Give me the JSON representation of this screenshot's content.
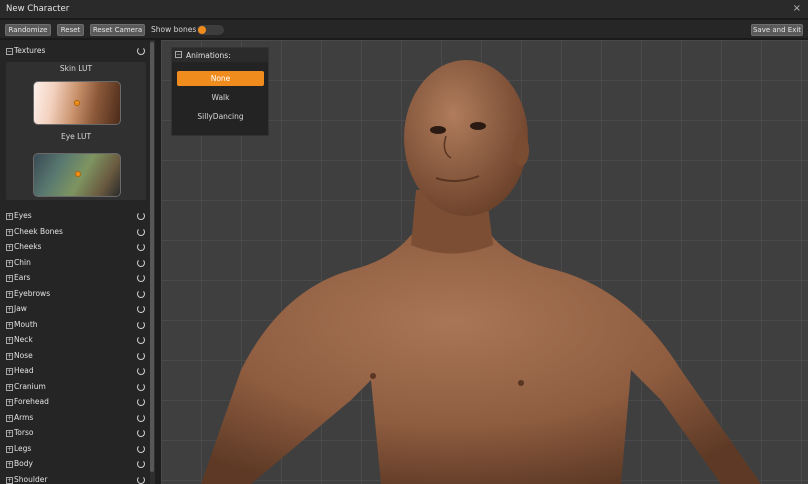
{
  "window": {
    "title": "New Character"
  },
  "toolbar": {
    "randomize": "Randomize",
    "reset": "Reset",
    "reset_camera": "Reset Camera",
    "show_bones": "Show bones",
    "show_bones_on": false,
    "save_and_exit": "Save and Exit"
  },
  "textures": {
    "header": "Textures",
    "skin_lut": "Skin LUT",
    "eye_lut": "Eye LUT"
  },
  "sections": [
    "Eyes",
    "Cheek Bones",
    "Cheeks",
    "Chin",
    "Ears",
    "Eyebrows",
    "Jaw",
    "Mouth",
    "Neck",
    "Nose",
    "Head",
    "Cranium",
    "Forehead",
    "Arms",
    "Torso",
    "Legs",
    "Body",
    "Shoulder"
  ],
  "animations": {
    "title": "Animations:",
    "items": [
      "None",
      "Walk",
      "SillyDancing"
    ],
    "selected": "None"
  },
  "colors": {
    "accent": "#f08c1e",
    "panel": "#252525",
    "viewport": "#3f3f3f",
    "skin": "#9a6a4a"
  }
}
